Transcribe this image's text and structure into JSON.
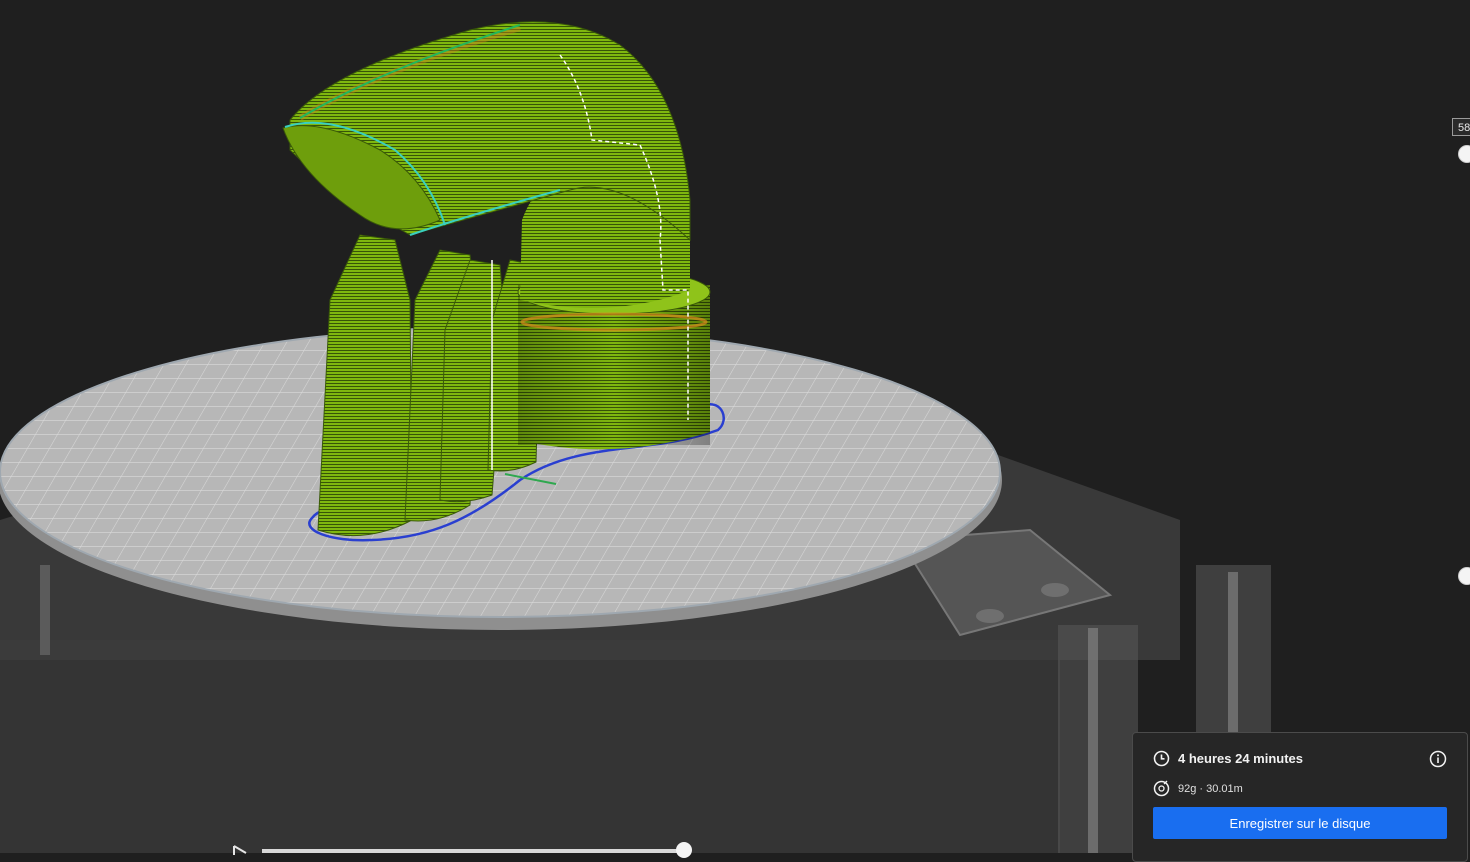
{
  "viewport": {
    "layer_value": "58",
    "model_color": "#7fb70f",
    "travel_color": "#2a3fd0"
  },
  "timeline": {
    "play_icon": "play-icon"
  },
  "print_info": {
    "time_icon": "clock-icon",
    "time_label": "4 heures 24 minutes",
    "info_icon": "info-icon",
    "material_icon": "spool-icon",
    "material_label": "92g · 30.01m",
    "save_label": "Enregistrer sur le disque",
    "accent": "#196ef0"
  }
}
